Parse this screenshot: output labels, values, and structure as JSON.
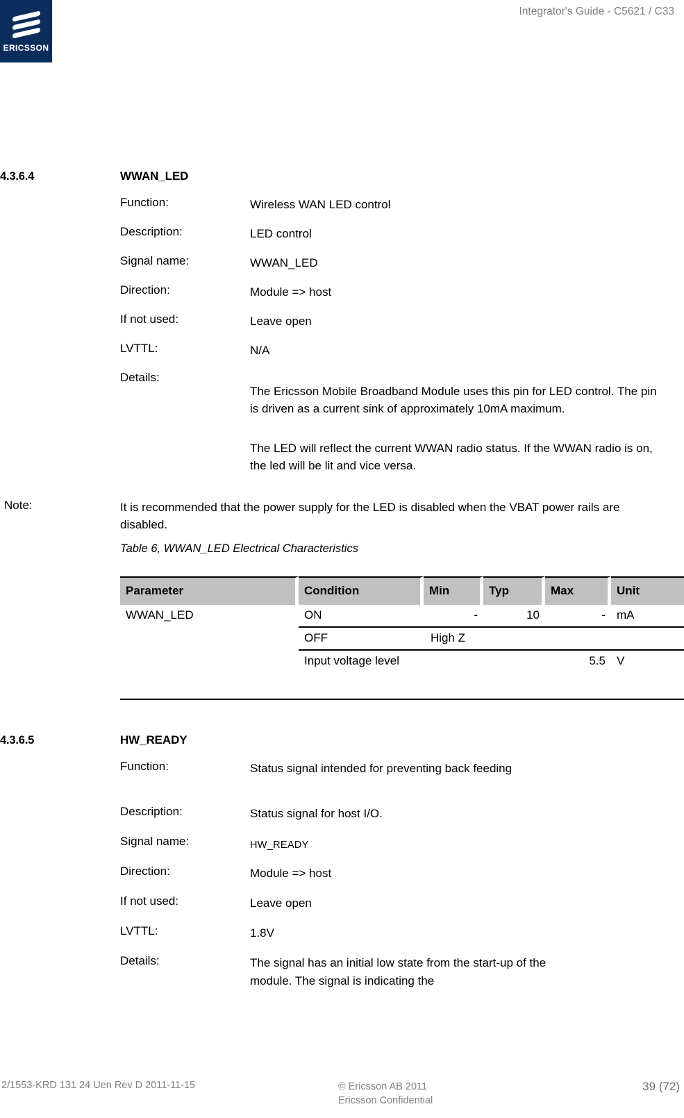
{
  "header": {
    "title": "Integrator's Guide - C5621 / C33",
    "logo_word": "ERICSSON"
  },
  "sections": [
    {
      "number": "4.3.6.4",
      "title": "WWAN_LED",
      "fields": [
        {
          "label": "Function:",
          "value": "Wireless WAN LED control"
        },
        {
          "label": "Description:",
          "value": "LED control"
        },
        {
          "label": "Signal name:",
          "value": "WWAN_LED"
        },
        {
          "label": "Direction:",
          "value": "Module => host"
        },
        {
          "label": "If not used:",
          "value": "Leave open"
        },
        {
          "label": "LVTTL:",
          "value": "N/A"
        },
        {
          "label": "Details:",
          "value": ""
        }
      ],
      "details_paragraphs": [
        "The Ericsson Mobile Broadband Module uses this pin for LED control. The pin is driven as a current sink of approximately 10mA maximum.",
        "The LED will reflect the current WWAN radio status. If the WWAN radio is on, the led will be lit and vice versa."
      ]
    },
    {
      "number": "4.3.6.5",
      "title": "HW_READY",
      "fields": [
        {
          "label": "Function:",
          "value": "Status signal intended for preventing back feeding"
        },
        {
          "label": "Description:",
          "value": "Status signal for host I/O."
        },
        {
          "label": "Signal name:",
          "value": "HW_READY"
        },
        {
          "label": "Direction:",
          "value": "Module => host"
        },
        {
          "label": "If not used:",
          "value": "Leave open"
        },
        {
          "label": "LVTTL:",
          "value": "1.8V"
        },
        {
          "label": "Details:",
          "value": "The signal has an initial low state from the start-up of the module. The signal is indicating the"
        }
      ]
    }
  ],
  "note": {
    "label": "Note:",
    "text": "It is recommended that the power supply for the LED is disabled when the VBAT power rails are disabled."
  },
  "table": {
    "caption": "Table 6, WWAN_LED Electrical Characteristics",
    "columns": [
      "Parameter",
      "Condition",
      "Min",
      "Typ",
      "Max",
      "Unit"
    ],
    "parameter": "WWAN_LED",
    "rows": [
      {
        "condition": "ON",
        "min": "-",
        "typ": "10",
        "max": "-",
        "unit": "mA"
      },
      {
        "condition": "OFF",
        "min": "High Z",
        "typ": "",
        "max": "",
        "unit": ""
      },
      {
        "condition": "Input voltage level",
        "min": "",
        "typ": "",
        "max": "5.5",
        "unit": "V"
      }
    ]
  },
  "footer": {
    "left": "2/1553-KRD 131 24 Uen  Rev D    2011-11-15",
    "center_line1": "© Ericsson AB 2011",
    "center_line2": "Ericsson Confidential",
    "right": "39 (72)"
  },
  "colors": {
    "logo_navy": "#0b2d5c",
    "table_header_gray": "#c0c0c0",
    "muted_text": "#808080"
  }
}
